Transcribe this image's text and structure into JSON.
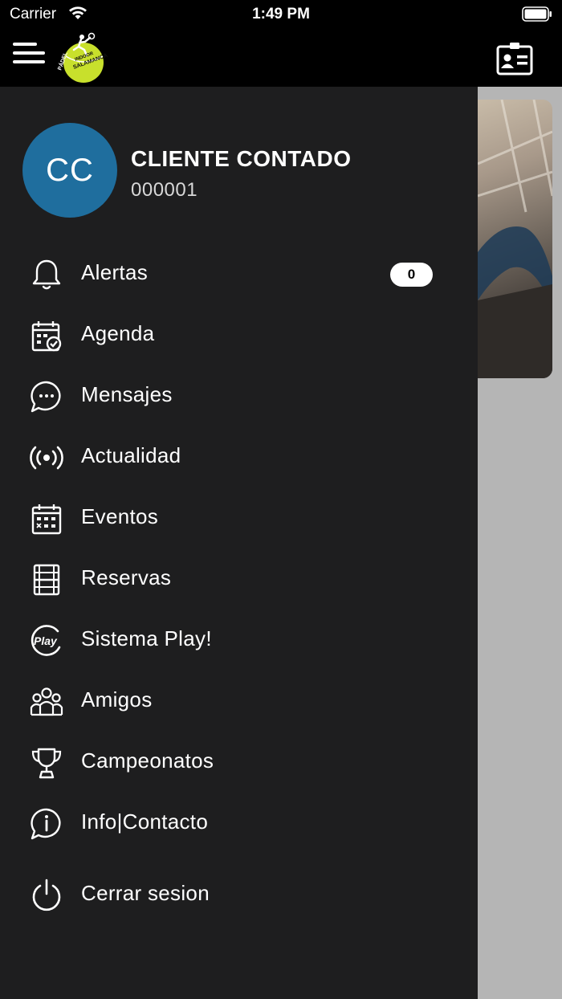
{
  "status_bar": {
    "carrier": "Carrier",
    "time": "1:49 PM"
  },
  "header": {
    "logo_icon": "padel-indoor-salamanca-logo",
    "menu_icon": "hamburger-icon",
    "action_icon": "id-card-icon"
  },
  "user": {
    "initials": "CC",
    "name": "CLIENTE CONTADO",
    "code": "000001",
    "avatar_color": "#1f6e9e"
  },
  "menu": [
    {
      "label": "Alertas",
      "icon": "bell-icon",
      "badge": "0"
    },
    {
      "label": "Agenda",
      "icon": "calendar-check-icon"
    },
    {
      "label": "Mensajes",
      "icon": "chat-bubble-icon"
    },
    {
      "label": "Actualidad",
      "icon": "broadcast-icon"
    },
    {
      "label": "Eventos",
      "icon": "calendar-grid-icon"
    },
    {
      "label": "Reservas",
      "icon": "court-icon"
    },
    {
      "label": "Sistema Play!",
      "icon": "play-logo-icon"
    },
    {
      "label": "Amigos",
      "icon": "group-icon"
    },
    {
      "label": "Campeonatos",
      "icon": "trophy-icon"
    },
    {
      "label": "Info|Contacto",
      "icon": "info-chat-icon"
    },
    {
      "label": "Cerrar sesion",
      "icon": "power-icon"
    }
  ]
}
